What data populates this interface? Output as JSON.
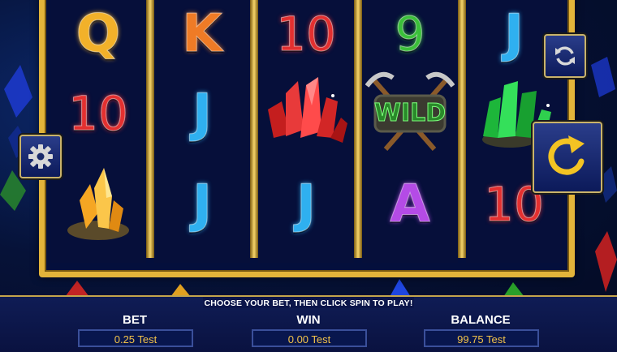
{
  "reels": [
    [
      {
        "kind": "letter",
        "text": "Q"
      },
      {
        "kind": "num",
        "text": "10"
      },
      {
        "kind": "gem",
        "icon": "orange-crystal-icon"
      }
    ],
    [
      {
        "kind": "letter",
        "text": "K"
      },
      {
        "kind": "letter",
        "text": "J"
      },
      {
        "kind": "letter",
        "text": "J"
      }
    ],
    [
      {
        "kind": "num",
        "text": "10"
      },
      {
        "kind": "gem",
        "icon": "red-crystal-icon"
      },
      {
        "kind": "letter",
        "text": "J"
      }
    ],
    [
      {
        "kind": "num",
        "text": "9"
      },
      {
        "kind": "wild",
        "text": "WILD",
        "icon": "pickaxe-wild-icon"
      },
      {
        "kind": "letter",
        "text": "A"
      }
    ],
    [
      {
        "kind": "letter",
        "text": "J"
      },
      {
        "kind": "gem",
        "icon": "green-crystal-icon"
      },
      {
        "kind": "num",
        "text": "10"
      }
    ]
  ],
  "controls": {
    "settings_icon": "gear-icon",
    "autoplay_icon": "autoplay-arrows-icon",
    "spin_icon": "spin-arrow-icon"
  },
  "footer": {
    "message": "CHOOSE YOUR BET, THEN CLICK SPIN TO PLAY!",
    "bet_label": "BET",
    "bet_value": "0.25 Test",
    "win_label": "WIN",
    "win_value": "0.00 Test",
    "balance_label": "BALANCE",
    "balance_value": "99.75 Test"
  },
  "colors": {
    "frame_gold": "#e3b43a",
    "value_text": "#f1c24a",
    "Q": "#f2b12a",
    "K": "#ef7b26",
    "10": "#e33030",
    "9": "#3bbf3a",
    "J": "#2fb0f0",
    "A": "#b44be6"
  }
}
